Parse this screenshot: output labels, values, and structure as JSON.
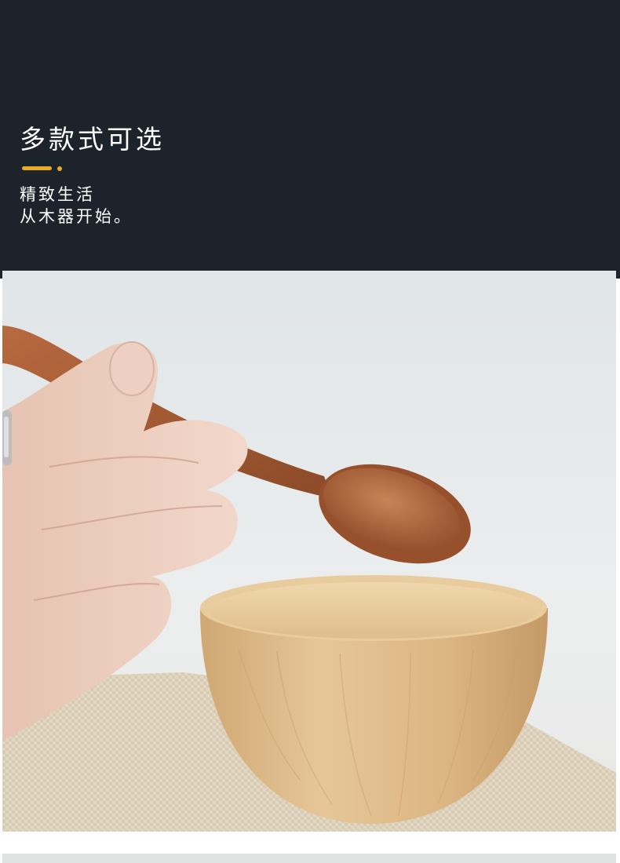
{
  "hero": {
    "title": "多款式可选",
    "subtitle_line1": "精致生活",
    "subtitle_line2": "从木器开始。",
    "background_color": "#1d232b",
    "accent_color": "#e7ad22"
  },
  "photo": {
    "subject_icon": "wooden-spoon-and-bowl-photo"
  }
}
